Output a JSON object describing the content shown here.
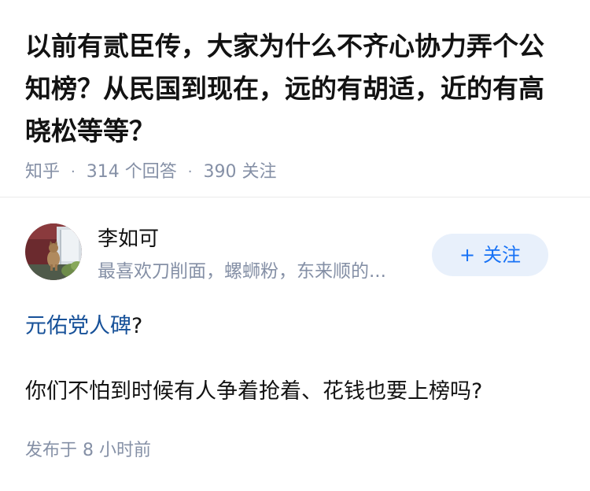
{
  "question": {
    "title": "以前有贰臣传，大家为什么不齐心协力弄个公知榜？从民国到现在，远的有胡适，近的有高晓松等等？",
    "source": "知乎",
    "answer_count": "314 个回答",
    "follower_count": "390 关注",
    "separator": "·"
  },
  "answer": {
    "author": {
      "name": "李如可",
      "bio": "最喜欢刀削面，螺蛳粉，东来顺的...",
      "follow_label": "关注",
      "follow_plus": "+"
    },
    "link_text": "元佑党人碑",
    "link_suffix": "?",
    "paragraph": "你们不怕到时候有人争着抢着、花钱也要上榜吗?",
    "post_time": "发布于  8 小时前"
  },
  "colors": {
    "accent": "#1772f6",
    "link": "#175199",
    "meta": "#8590a6",
    "follow_bg": "#e8f0fb"
  },
  "icons": {
    "avatar": "cat-photo-avatar"
  }
}
